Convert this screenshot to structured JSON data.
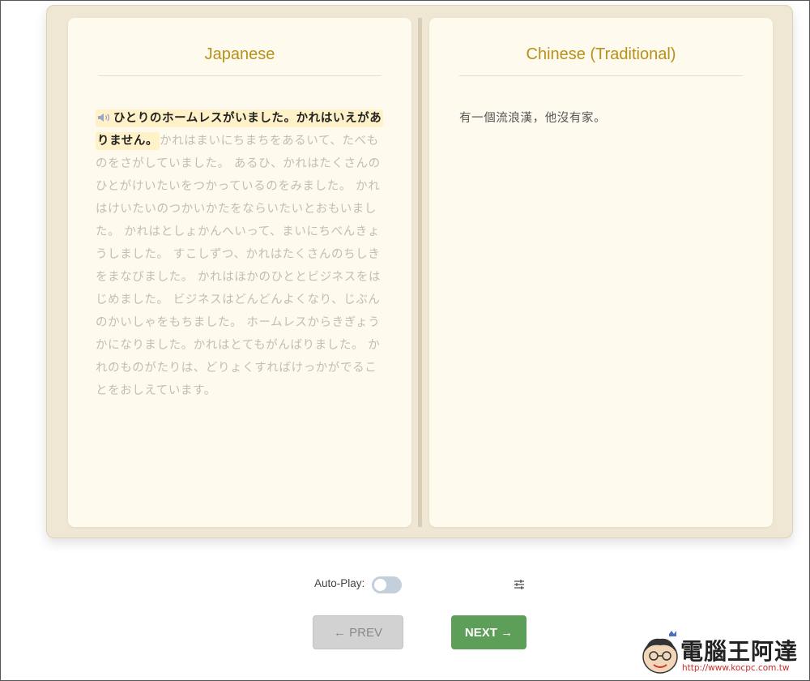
{
  "left_page": {
    "title": "Japanese",
    "highlighted_sentence": "ひとりのホームレスがいました。かれはいえがありません。",
    "remaining_text": "かれはまいにちまちをあるいて、たべものをさがしていました。 あるひ、かれはたくさんのひとがけいたいをつかっているのをみました。 かれはけいたいのつかいかたをならいたいとおもいました。 かれはとしょかんへいって、まいにちべんきょうしました。 すこしずつ、かれはたくさんのちしきをまなびました。 かれはほかのひととビジネスをはじめました。 ビジネスはどんどんよくなり、じぶんのかいしゃをもちました。 ホームレスからきぎょうかになりました。かれはとてもがんばりました。 かれのものがたりは、どりょくすればけっかがでることをおしえています。"
  },
  "right_page": {
    "title": "Chinese (Traditional)",
    "text": "有一個流浪漢，他沒有家。"
  },
  "controls": {
    "autoplay_label": "Auto-Play:",
    "autoplay_on": false,
    "prev_label": "← PREV",
    "next_label": "NEXT →"
  },
  "watermark": {
    "text": "電腦王阿達",
    "url": "http://www.kocpc.com.tw"
  },
  "colors": {
    "title_gold": "#b8901a",
    "highlight": "#fff1c8",
    "next_green": "#5d9e59",
    "book_frame": "#efe7d3"
  }
}
